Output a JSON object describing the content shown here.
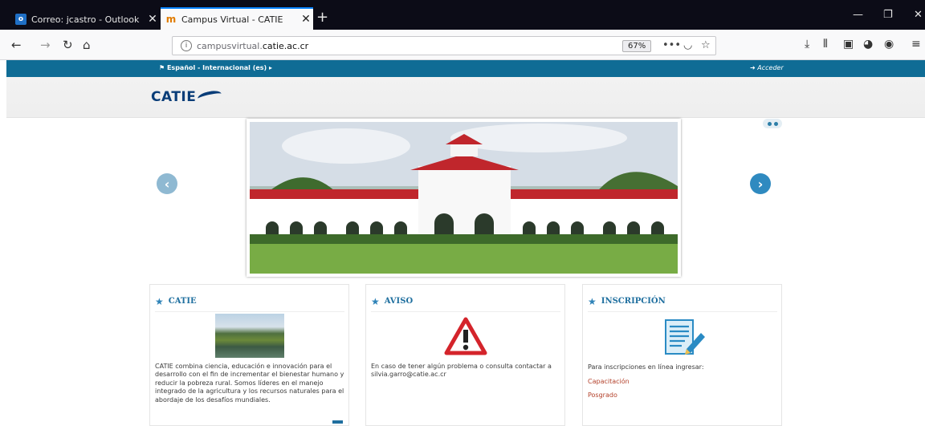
{
  "browser": {
    "tabs": [
      {
        "title": "Correo: jcastro - Outlook",
        "favicon": "outlook-icon",
        "active": false
      },
      {
        "title": "Campus Virtual - CATIE",
        "favicon": "catie-icon",
        "active": true
      }
    ],
    "new_tab": "+",
    "address": {
      "prefix": "campusvirtual.",
      "host": "catie.ac.cr"
    },
    "zoom": "67%"
  },
  "site": {
    "language_menu": "Español - Internacional (es) ▸",
    "login": "Acceder",
    "logo_text": "CATIE",
    "accent_color": "#0f6c95"
  },
  "blocks": [
    {
      "title": "CATIE",
      "text": "CATIE combina ciencia, educación e innovación para el desarrollo con el fin de incrementar el bienestar humano y reducir la pobreza rural. Somos líderes en el manejo integrado de la agricultura y los recursos naturales para el abordaje de los desafíos mundiales."
    },
    {
      "title": "AVISO",
      "text": "En caso de tener algún problema o consulta contactar a silvia.garro@catie.ac.cr"
    },
    {
      "title": "INSCRIPCIÓN",
      "text": "Para inscripciones en línea ingresar:",
      "links": [
        "Capacitación",
        "Posgrado"
      ]
    }
  ]
}
